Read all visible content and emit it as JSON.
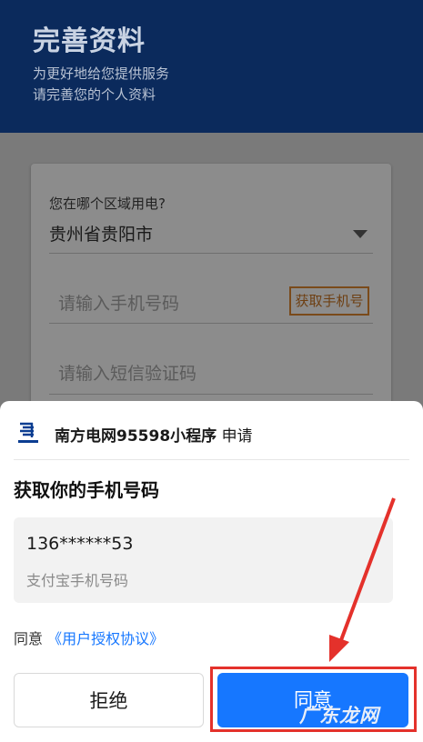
{
  "header": {
    "title": "完善资料",
    "subtitle_line1": "为更好地给您提供服务",
    "subtitle_line2": "请完善您的个人资料"
  },
  "form": {
    "region_question": "您在哪个区域用电?",
    "region_value": "贵州省贵阳市",
    "phone_placeholder": "请输入手机号码",
    "get_phone_label": "获取手机号",
    "sms_placeholder": "请输入短信验证码"
  },
  "sheet": {
    "app_name": "南方电网95598小程序",
    "app_action": "申请",
    "heading": "获取你的手机号码",
    "phone_number": "136******53",
    "phone_desc": "支付宝手机号码",
    "agree_prefix": "同意",
    "agree_link": "《用户授权协议》",
    "reject_label": "拒绝",
    "agree_label": "同意",
    "watermark": "广东龙网"
  },
  "colors": {
    "accent": "#1677ff",
    "highlight": "#e4312b",
    "header_bg": "#0b2a5c"
  },
  "icons": {
    "logo": "china-southern-grid-logo",
    "dropdown": "caret-down-icon"
  }
}
